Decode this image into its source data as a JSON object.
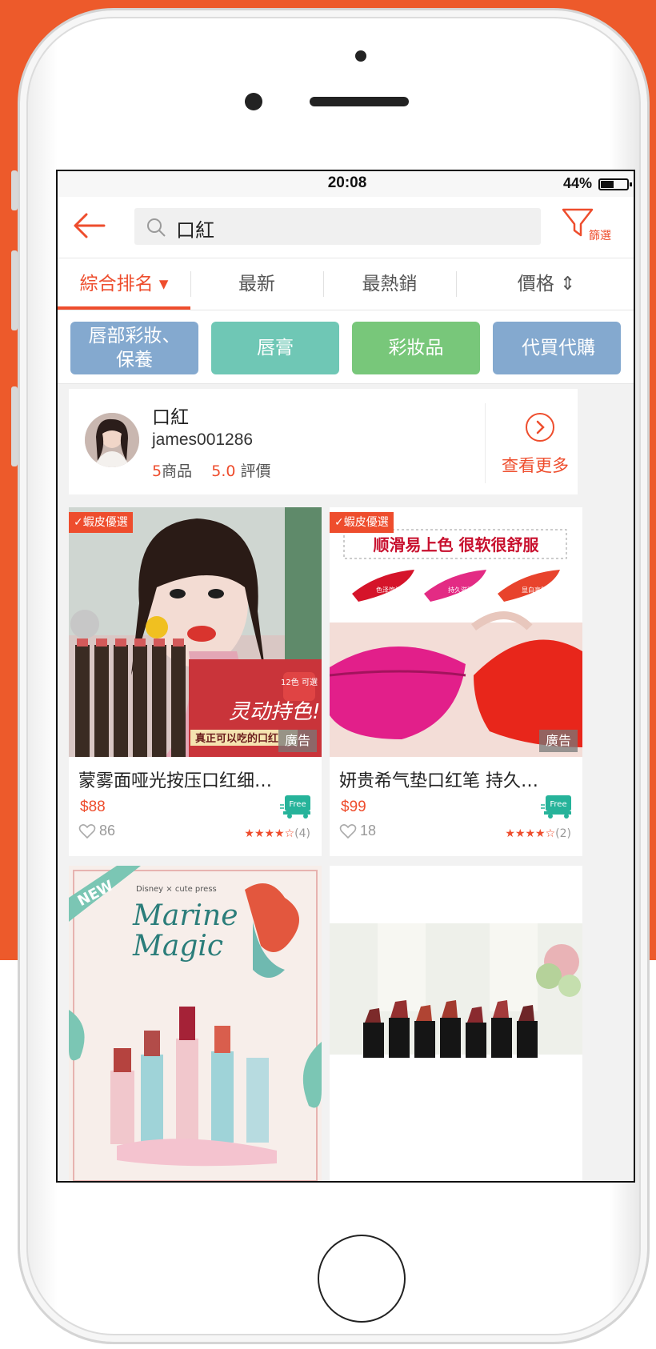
{
  "status_bar": {
    "time": "20:08",
    "battery": "44%"
  },
  "search": {
    "query": "口紅",
    "filter_label": "篩選"
  },
  "sort_tabs": [
    {
      "label": "綜合排名 ▾",
      "active": true
    },
    {
      "label": "最新",
      "active": false
    },
    {
      "label": "最熱銷",
      "active": false
    },
    {
      "label": "價格 ⇕",
      "active": false
    }
  ],
  "chips": [
    {
      "line1": "唇部彩妝、",
      "line2": "保養",
      "color": "#84a9cf"
    },
    {
      "line1": "唇膏",
      "line2": "",
      "color": "#6fc7b5"
    },
    {
      "line1": "彩妝品",
      "line2": "",
      "color": "#78c77a"
    },
    {
      "line1": "代買代購",
      "line2": "",
      "color": "#84a9cf"
    }
  ],
  "shop": {
    "name": "口紅",
    "username": "james001286",
    "products_count": "5",
    "products_label": "商品",
    "rating_value": "5.0",
    "rating_label": "評價",
    "more_label": "查看更多"
  },
  "products": [
    {
      "badge": "✓蝦皮優選",
      "ad": "廣告",
      "title": "蒙雾面哑光按压口红细…",
      "price": "$88",
      "likes": "86",
      "stars": "★★★★☆",
      "rating_count": "(4)",
      "image_texts": {
        "banner": "灵动持色!",
        "sub": "真正可以吃的口红",
        "tag": "12色 可選"
      }
    },
    {
      "badge": "✓蝦皮優選",
      "ad": "廣告",
      "title": "妍贵希气垫口红笔 持久…",
      "price": "$99",
      "likes": "18",
      "stars": "★★★★☆",
      "rating_count": "(2)",
      "image_texts": {
        "headline": "顺滑易上色 很软很舒服",
        "s1": "色泽饱满",
        "s2": "持久滋润",
        "s3": "显白亮肤"
      }
    },
    {
      "image_texts": {
        "new": "NEW",
        "brand": "Disney × cute press",
        "t1": "Marine",
        "t2": "Magic"
      }
    },
    {}
  ],
  "free_label": "Free",
  "colors": {
    "accent": "#ee4d2d",
    "frame_bg": "#ed5a2b"
  }
}
